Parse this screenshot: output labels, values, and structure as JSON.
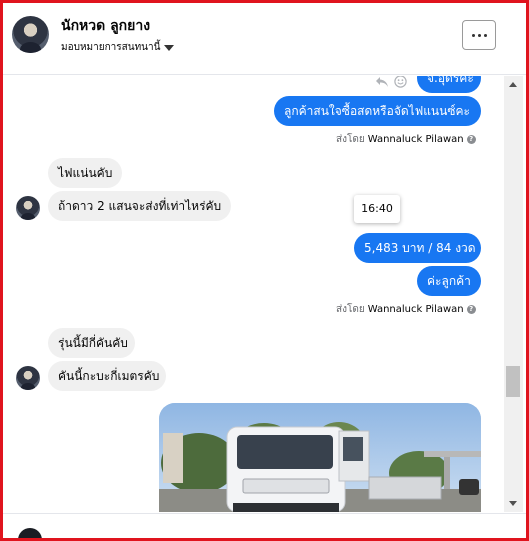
{
  "header": {
    "name": "นักหวด ลูกยาง",
    "subtitle": "มอบหมายการสนทนานี้"
  },
  "messages": [
    {
      "text": "จ.อุดรคะ",
      "direction": "out"
    },
    {
      "text": "ลูกค้าสนใจซื้อสดหรือจัดไฟแนนซ์คะ",
      "direction": "out"
    },
    {
      "text": "ไฟแน่นคับ",
      "direction": "in"
    },
    {
      "text": "ถ้าดาว 2 แสนจะส่งที่เท่าไหร่คับ",
      "direction": "in"
    },
    {
      "text": "5,483 บาท / 84 งวด",
      "direction": "out"
    },
    {
      "text": "ค่ะลูกค้า",
      "direction": "out"
    },
    {
      "text": "รุ่นนี้มีกี่คันคับ",
      "direction": "in"
    },
    {
      "text": "คันนี้กะบะกี่เมตรคับ",
      "direction": "in"
    }
  ],
  "sent_by_1": {
    "prefix": "ส่งโดย",
    "agent": "Wannaluck Pilawan"
  },
  "sent_by_2": {
    "prefix": "ส่งโดย",
    "agent": "Wannaluck Pilawan"
  },
  "timestamp": "16:40",
  "colors": {
    "accent": "#1877f2",
    "incoming": "#f0f0f0",
    "frame": "#e0141e"
  },
  "icons": [
    "more-icon",
    "caret-down-icon",
    "reply-icon",
    "react-icon",
    "help-icon"
  ]
}
